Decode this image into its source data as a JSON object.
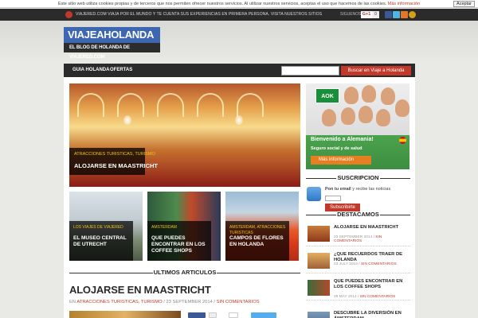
{
  "cookie": {
    "text": "Este sitio web utiliza cookies propias y de terceros que nos permiten ofrecer nuestros servicios. Al utilizar nuestros servicios, aceptas el uso que hacemos de las cookies.",
    "more_label": "Más información",
    "accept_label": "Aceptar"
  },
  "topbar": {
    "text": "Viajered.com viaja por el mundo y te cuenta sus experiencias en primera persona. Visita nuestros sitios",
    "follow_label": "SIGUENOS EN",
    "gplus_label": "G+1",
    "gplus_count": "0"
  },
  "header": {
    "logo_text": "VIAJEAHOLANDA",
    "logo_sub": "EL BLOG DE HOLANDA DE VIAJERED.COM"
  },
  "nav": {
    "items": [
      "GUIA HOLANDA",
      "OFERTAS"
    ],
    "search_button": "Buscar en Viaje a Holanda"
  },
  "hero": {
    "category": "ATRACCIONES TURISTICAS, TURISMO",
    "title": "ALOJARSE EN MAASTRICHT"
  },
  "thumbs": [
    {
      "category": "LOS VIAJES DE VIAJERED",
      "title": "EL MUSEO CENTRAL DE UTRECHT"
    },
    {
      "category": "AMSTERDAM",
      "title": "QUE PUEDES ENCONTRAR EN LOS COFFEE SHOPS"
    },
    {
      "category": "AMSTERDAM, ATRACCIONES TURISTICAS",
      "title": "CAMPOS DE FLORES EN HOLANDA"
    }
  ],
  "ad": {
    "brand": "AOK",
    "headline": "Bienvenido a Alemania!",
    "subline": "Seguro social y de salud",
    "button": "Más información"
  },
  "subscription": {
    "heading": "SUSCRIPCION",
    "text_bold": "Pon tu email",
    "text_rest": " y recibe las noticias",
    "button": "Subscribirte"
  },
  "featured": {
    "heading": "DESTACAMOS",
    "items": [
      {
        "title": "ALOJARSE EN MAASTRICHT",
        "date": "23 SEPTEMBER 2014 /",
        "comments": "SIN COMENTARIOS"
      },
      {
        "title": "¿QUE RECUERDOS TRAER DE HOLANDA",
        "date": "23 JULY 2014 /",
        "comments": "SIN COMENTARIOS"
      },
      {
        "title": "QUE PUEDES ENCONTRAR EN LOS COFFEE SHOPS",
        "date": "29 MAY 2014 /",
        "comments": "SIN COMENTARIOS"
      },
      {
        "title": "DESCUBRE LA DIVERSIÓN EN ÁMSTERDAM",
        "date": "",
        "comments": ""
      }
    ]
  },
  "latest": {
    "heading": "ULTIMOS ARTICULOS",
    "title": "ALOJARSE EN MAASTRICHT",
    "meta_prefix": "EN ",
    "meta_categories": "ATRACCIONES TURISTICAS, TURISMO",
    "meta_date": " / 23 SEPTEMBER 2014 / ",
    "meta_comments": "SIN COMENTARIOS"
  },
  "colors": {
    "accent": "#c0392b",
    "logo_blue": "#3d67b1",
    "dark_bar": "#2b2b2b",
    "category_yellow": "#f1c40f"
  }
}
